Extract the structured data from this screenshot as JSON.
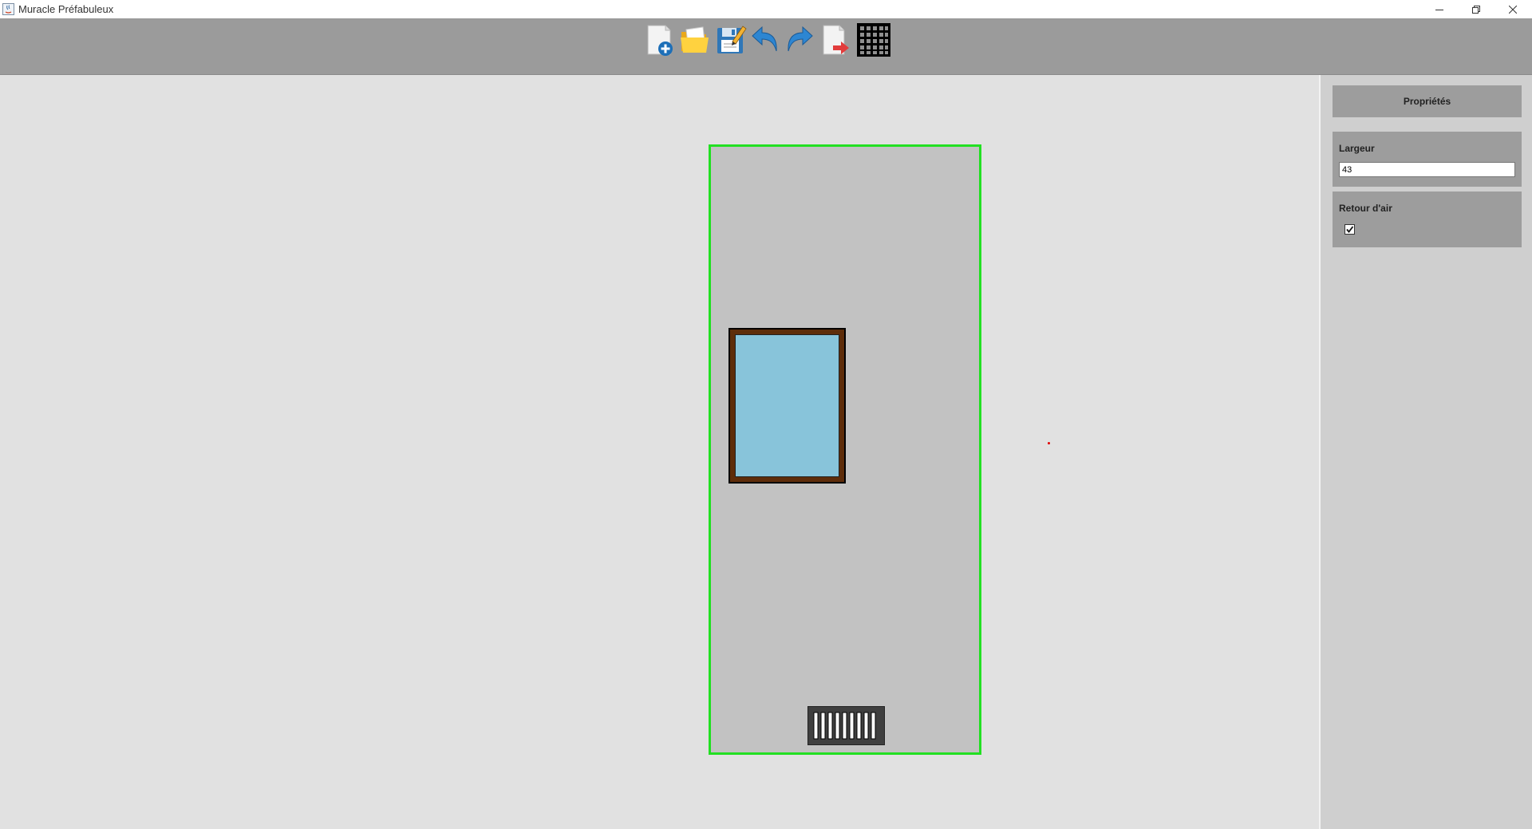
{
  "window": {
    "title": "Muracle Préfabuleux",
    "icons": {
      "minimize": "minimize-icon",
      "restore": "restore-icon",
      "close": "close-icon"
    }
  },
  "toolbar": {
    "tools": [
      {
        "name": "new-file-icon"
      },
      {
        "name": "open-folder-icon"
      },
      {
        "name": "save-icon"
      },
      {
        "name": "undo-icon"
      },
      {
        "name": "redo-icon"
      },
      {
        "name": "export-icon"
      },
      {
        "name": "grid-icon"
      }
    ]
  },
  "canvas": {
    "colors": {
      "background": "#e1e1e1",
      "wall_fill": "#c2c2c2",
      "selection_outline": "#22e022",
      "window_frame": "#5e2d0a",
      "window_glass": "#88c4da",
      "grille": "#3f3f3f",
      "marker": "#e00000"
    }
  },
  "properties": {
    "title": "Propriétés",
    "width_label": "Largeur",
    "width_value": "43",
    "air_return_label": "Retour d'air",
    "air_return_checked": true
  }
}
